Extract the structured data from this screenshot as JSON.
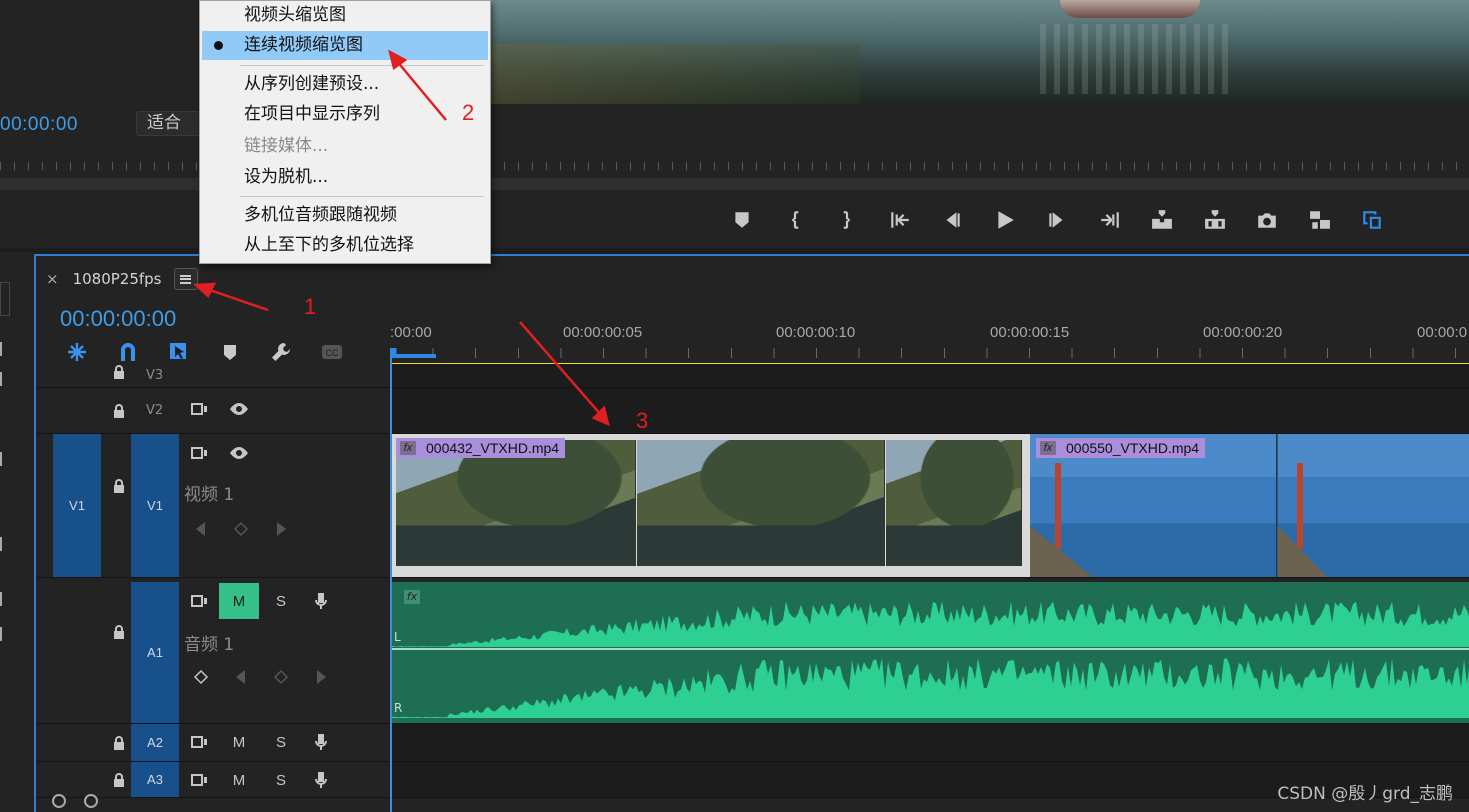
{
  "monitor": {
    "timecode": "00:00:00",
    "fit_label": "适合",
    "transport_icons": [
      "marker-icon",
      "mark-in-icon",
      "mark-out-icon",
      "go-to-in-icon",
      "step-back-icon",
      "play-icon",
      "step-forward-icon",
      "go-to-out-icon",
      "insert-icon",
      "overwrite-icon",
      "export-frame-icon",
      "comparison-view-icon",
      "multi-camera-icon"
    ]
  },
  "context_menu": {
    "items": [
      {
        "label": "视频头缩览图",
        "disabled": false
      },
      {
        "label": "连续视频缩览图",
        "checked": true
      },
      {
        "label": "从序列创建预设..."
      },
      {
        "label": "在项目中显示序列"
      },
      {
        "label": "链接媒体...",
        "disabled": true
      },
      {
        "label": "设为脱机..."
      },
      {
        "label": "多机位音频跟随视频"
      },
      {
        "label": "从上至下的多机位选择"
      }
    ]
  },
  "timeline": {
    "sequence_name": "1080P25fps",
    "close_label": "×",
    "timecode": "00:00:00:00",
    "ruler_labels": [
      ":00:00",
      "00:00:00:05",
      "00:00:00:10",
      "00:00:00:15",
      "00:00:00:20",
      "00:00:0"
    ],
    "tracks": {
      "v3": {
        "label": "V3"
      },
      "v2": {
        "label": "V2"
      },
      "v1": {
        "source": "V1",
        "label": "V1",
        "name": "视频 1"
      },
      "a1": {
        "label": "A1",
        "name": "音频 1",
        "mute": "M",
        "solo": "S",
        "channel_left": "L",
        "channel_right": "R"
      },
      "a2": {
        "label": "A2",
        "mute": "M",
        "solo": "S"
      },
      "a3": {
        "label": "A3",
        "mute": "M",
        "solo": "S"
      }
    },
    "clips": [
      {
        "name": "000432_VTXHD.mp4",
        "fx": "fx"
      },
      {
        "name": "000550_VTXHD.mp4",
        "fx": "fx"
      }
    ],
    "audio_fx": "fx"
  },
  "annotations": [
    "1",
    "2",
    "3"
  ],
  "watermark": "CSDN @殷丿grd_志鹏",
  "colors": {
    "accent": "#2d8ceb",
    "timecode": "#3f9ce8",
    "mute_on": "#35c08a",
    "audio_wave": "#2ecf93",
    "work_area": "#e5e21d",
    "clip_label": "#a98edc",
    "annotation": "#e02020"
  }
}
